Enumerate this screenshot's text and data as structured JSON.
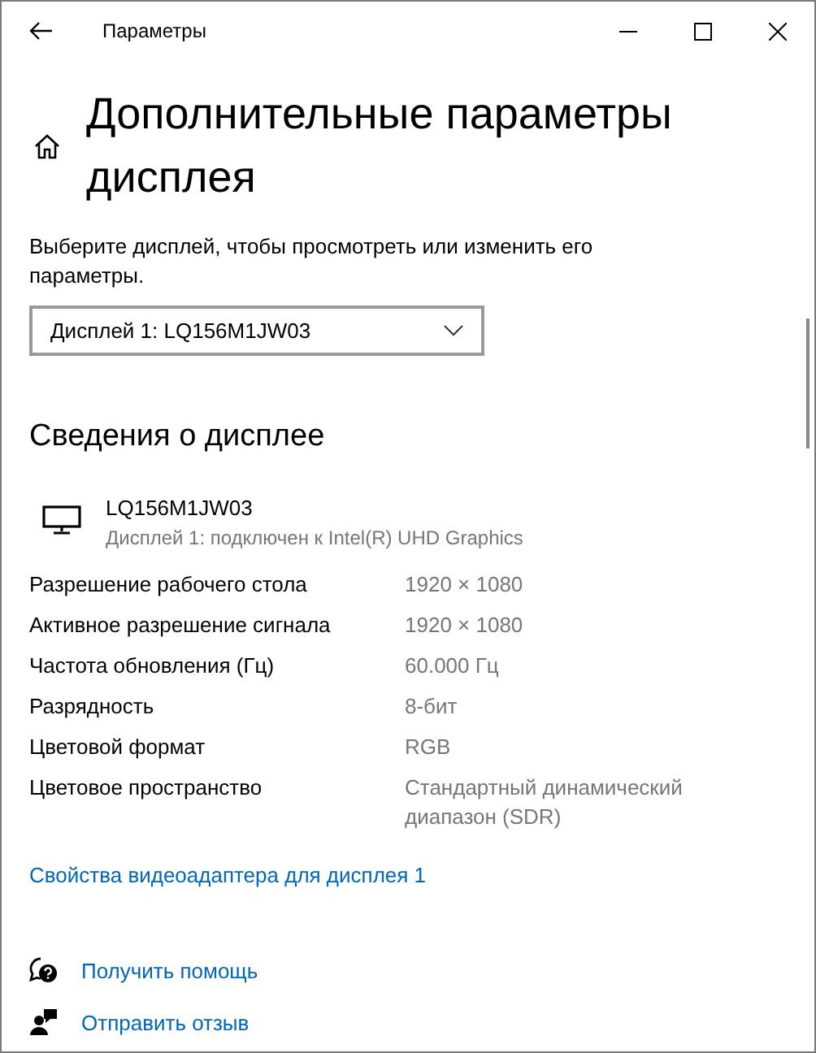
{
  "window": {
    "title": "Параметры"
  },
  "page": {
    "title": "Дополнительные параметры дисплея",
    "description": "Выберите дисплей, чтобы просмотреть или изменить его параметры.",
    "display_select": {
      "value": "Дисплей 1: LQ156M1JW03"
    }
  },
  "display_info": {
    "heading": "Сведения о дисплее",
    "name": "LQ156M1JW03",
    "subtitle": "Дисплей 1: подключен к Intel(R) UHD Graphics",
    "rows": [
      {
        "label": "Разрешение рабочего стола",
        "value": "1920 × 1080"
      },
      {
        "label": "Активное разрешение сигнала",
        "value": "1920 × 1080"
      },
      {
        "label": "Частота обновления (Гц)",
        "value": "60.000 Гц"
      },
      {
        "label": "Разрядность",
        "value": "8-бит"
      },
      {
        "label": "Цветовой формат",
        "value": "RGB"
      },
      {
        "label": "Цветовое пространство",
        "value": "Стандартный динамический диапазон (SDR)"
      }
    ],
    "link": "Свойства видеоадаптера для дисплея 1"
  },
  "help_links": [
    {
      "kind": "help",
      "label": "Получить помощь"
    },
    {
      "kind": "feedback",
      "label": "Отправить отзыв"
    }
  ]
}
